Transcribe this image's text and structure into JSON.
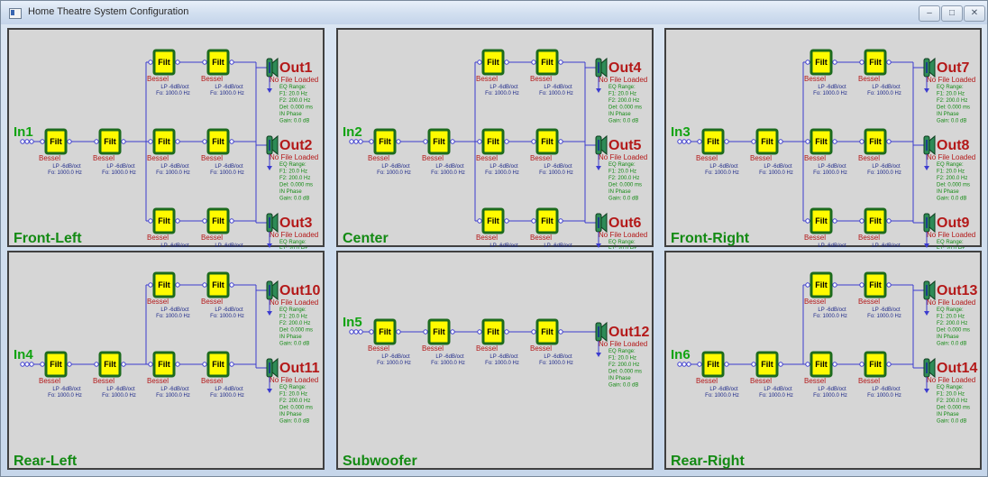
{
  "window": {
    "title": "Home Theatre System Configuration",
    "controls": {
      "minimize": "–",
      "maximize": "□",
      "close": "✕"
    }
  },
  "filter": {
    "label": "Filt",
    "type": "Bessel",
    "param_line1": "LP -6dB/oct",
    "param_line2": "Fo: 1000.0 Hz"
  },
  "output_info": {
    "no_file": "No File Loaded",
    "eq_range": "EQ Range:",
    "f1": "F1: 20.0 Hz",
    "f2": "F2: 200.0 Hz",
    "delay": "Del: 0.000 ms",
    "phase": "IN Phase",
    "gain": "Gain: 0.0 dB"
  },
  "panels": [
    {
      "name": "Front-Left",
      "input": "In1",
      "layout": "triple",
      "outputs": [
        "Out1",
        "Out2",
        "Out3"
      ]
    },
    {
      "name": "Center",
      "input": "In2",
      "layout": "triple",
      "outputs": [
        "Out4",
        "Out5",
        "Out6"
      ]
    },
    {
      "name": "Front-Right",
      "input": "In3",
      "layout": "triple",
      "outputs": [
        "Out7",
        "Out8",
        "Out9"
      ]
    },
    {
      "name": "Rear-Left",
      "input": "In4",
      "layout": "double",
      "outputs": [
        "Out10",
        "Out11"
      ]
    },
    {
      "name": "Subwoofer",
      "input": "In5",
      "layout": "single",
      "outputs": [
        "Out12"
      ]
    },
    {
      "name": "Rear-Right",
      "input": "In6",
      "layout": "double",
      "outputs": [
        "Out13",
        "Out14"
      ]
    }
  ]
}
